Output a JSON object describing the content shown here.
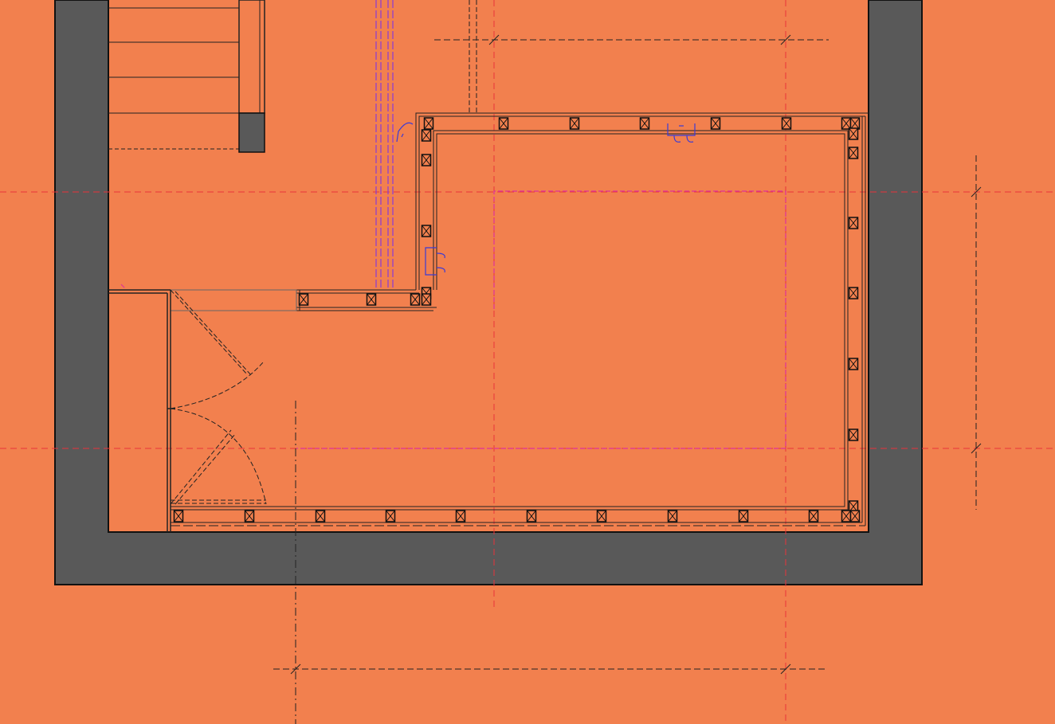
{
  "drawing": {
    "view": "floor-plan",
    "colors": {
      "background": "#f2804e",
      "wall_fill": "#595959",
      "line": "#1a1a1a",
      "gridline": "#e8343a",
      "pink_outline": "#e0309a",
      "blue_symbol": "#3a3ad6",
      "purple_pipe": "#8a3ad6"
    }
  }
}
